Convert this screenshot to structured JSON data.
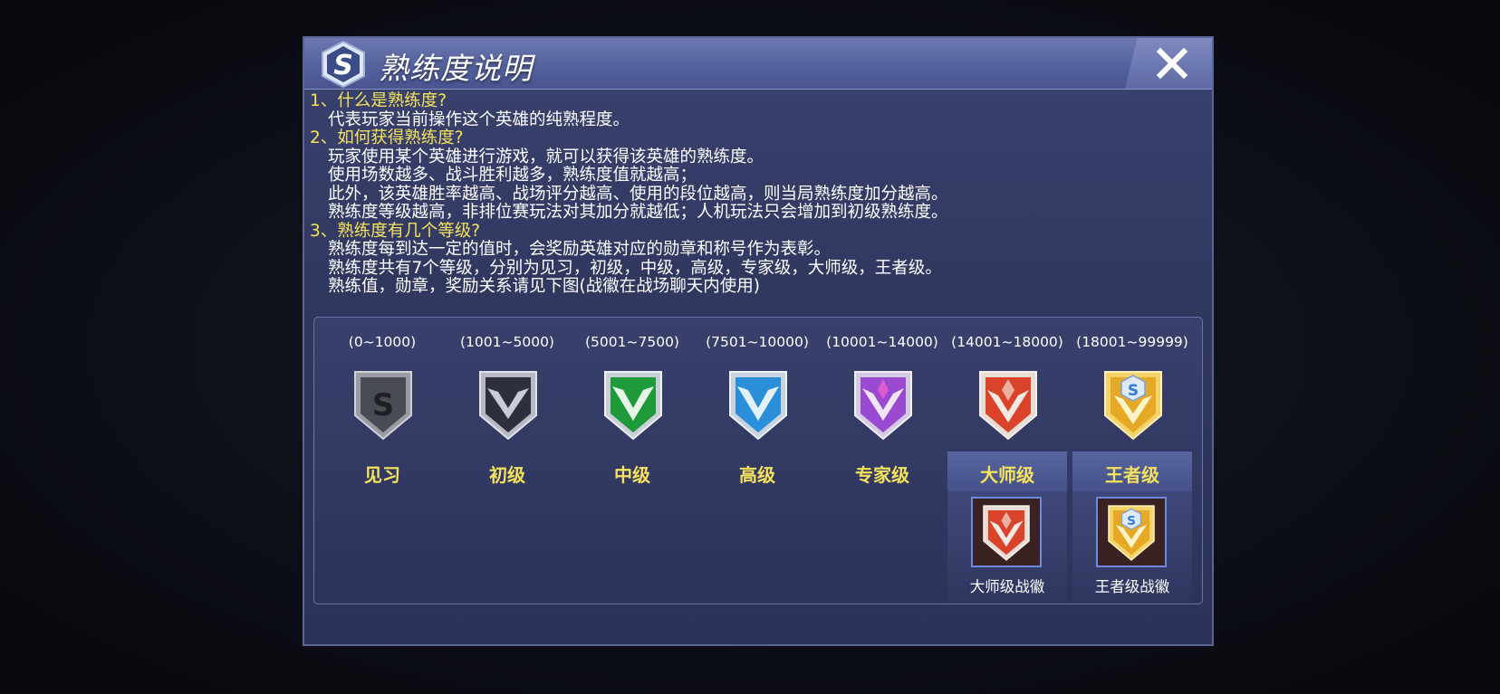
{
  "dialog": {
    "title": "熟练度说明",
    "sections": [
      {
        "question": "1、什么是熟练度?",
        "answers": [
          "代表玩家当前操作这个英雄的纯熟程度。"
        ]
      },
      {
        "question": "2、如何获得熟练度?",
        "answers": [
          "玩家使用某个英雄进行游戏，就可以获得该英雄的熟练度。",
          "使用场数越多、战斗胜利越多，熟练度值就越高；",
          "此外，该英雄胜率越高、战场评分越高、使用的段位越高，则当局熟练度加分越高。",
          "熟练度等级越高，非排位赛玩法对其加分就越低；人机玩法只会增加到初级熟练度。"
        ]
      },
      {
        "question": "3、熟练度有几个等级?",
        "answers": [
          "熟练度每到达一定的值时，会奖励英雄对应的勋章和称号作为表彰。",
          "熟练度共有7个等级，分别为见习，初级，中级，高级，专家级，大师级，王者级。",
          "熟练值，勋章，奖励关系请见下图(战徽在战场聊天内使用)"
        ]
      }
    ],
    "tiers": [
      {
        "range": "(0~1000)",
        "name": "见习",
        "badge": "gray-s-shield-icon"
      },
      {
        "range": "(1001~5000)",
        "name": "初级",
        "badge": "dark-silver-shield-icon"
      },
      {
        "range": "(5001~7500)",
        "name": "中级",
        "badge": "green-shield-icon"
      },
      {
        "range": "(7501~10000)",
        "name": "高级",
        "badge": "blue-shield-icon"
      },
      {
        "range": "(10001~14000)",
        "name": "专家级",
        "badge": "purple-shield-icon"
      },
      {
        "range": "(14001~18000)",
        "name": "大师级",
        "badge": "red-shield-icon",
        "emblem": "大师级战徽"
      },
      {
        "range": "(18001~99999)",
        "name": "王者级",
        "badge": "gold-s-shield-icon",
        "emblem": "王者级战徽"
      }
    ]
  },
  "colors": {
    "question_text": "#f4e25c",
    "answer_text": "#ffffff",
    "tier_name": "#f4e25c",
    "badge_gray": "#5b5e66",
    "badge_dark": "#3a3a48",
    "badge_green": "#1f9a3a",
    "badge_blue": "#2a8fd8",
    "badge_purple": "#9a4ad0",
    "badge_red": "#d8432a",
    "badge_gold": "#e6a925"
  }
}
